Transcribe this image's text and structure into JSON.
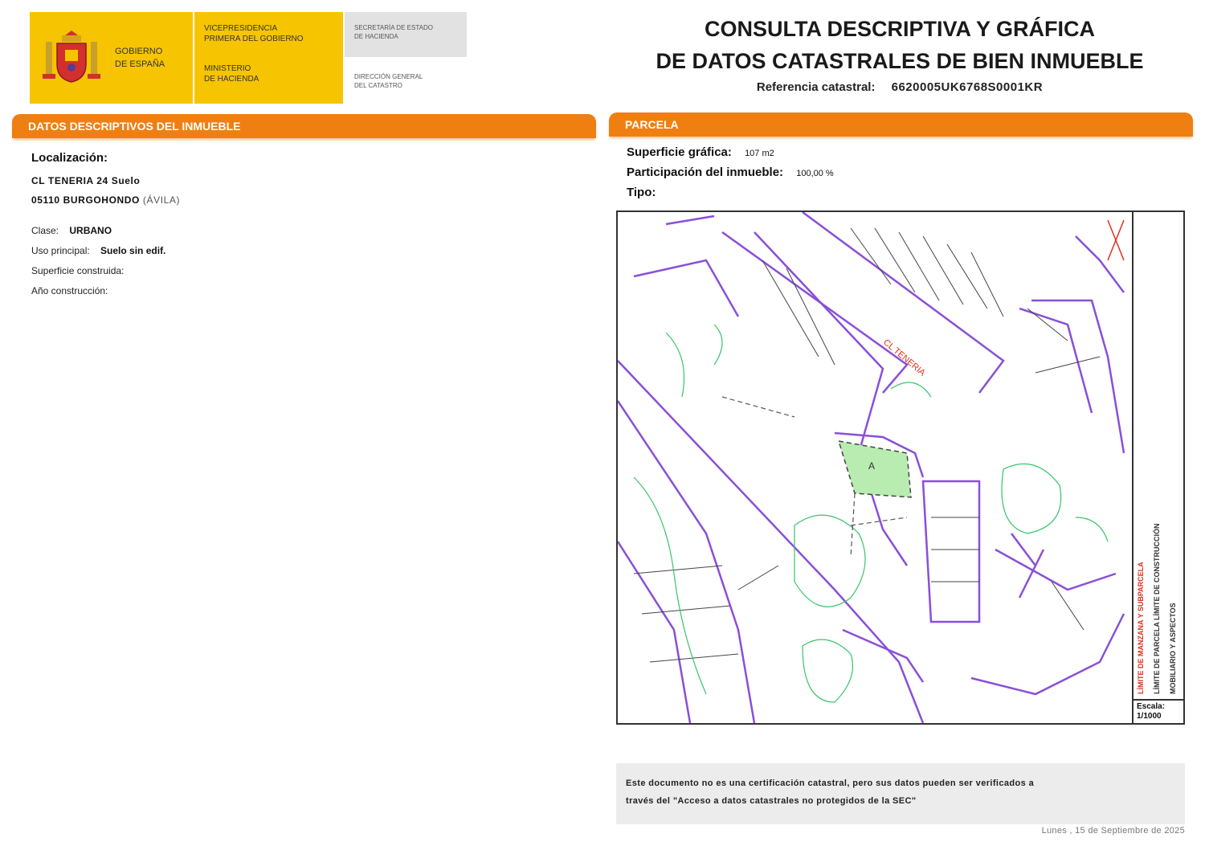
{
  "header": {
    "gov_name": [
      "GOBIERNO",
      "DE ESPAÑA"
    ],
    "vice_presidency": [
      "VICEPRESIDENCIA",
      "PRIMERA DEL GOBIERNO"
    ],
    "ministry": [
      "MINISTERIO",
      "DE HACIENDA"
    ],
    "secretariat": [
      "SECRETARÍA DE ESTADO",
      "DE HACIENDA"
    ],
    "directorate": [
      "DIRECCIÓN GENERAL",
      "DEL CATASTRO"
    ],
    "title_line1": "CONSULTA DESCRIPTIVA Y GRÁFICA",
    "title_line2": "DE DATOS CATASTRALES DE BIEN INMUEBLE",
    "ref_label": "Referencia catastral:",
    "ref_value": "6620005UK6768S0001KR"
  },
  "left_section": {
    "title": "DATOS DESCRIPTIVOS DEL INMUEBLE",
    "location_label": "Localización:",
    "address_line1": "CL TENERIA 24 Suelo",
    "address_line2": "05110 BURGOHONDO",
    "address_province": "(ÁVILA)",
    "clase_label": "Clase:",
    "clase_value": "URBANO",
    "uso_label": "Uso principal:",
    "uso_value": "Suelo sin edif.",
    "superficie_label": "Superficie construida:",
    "anio_label": "Año construcción:"
  },
  "right_section": {
    "title": "PARCELA",
    "superficie_label": "Superficie gráfica:",
    "superficie_value": "107 m2",
    "participacion_label": "Participación del inmueble:",
    "participacion_value": "100,00 %",
    "tipo_label": "Tipo:"
  },
  "map": {
    "street_label": "CL TENERIA",
    "scale_label": "Escala:",
    "scale_value": "1/1000",
    "legend_red": "LÍMITE DE MANZANA Y SUBPARCELA",
    "legend_mid": "LÍMITE DE PARCELA LÍMITE DE CONSTRUCCIÓN",
    "legend_right": "MOBILIARIO Y ASPECTOS",
    "colors": {
      "parcel_outline": "#8a4fd8",
      "vegetation": "#38c46a",
      "highlight": "#b8ecb0",
      "red_text": "#e0301e"
    }
  },
  "footer": {
    "disclaimer_line1": "Este documento no es una certificación catastral, pero sus datos pueden ser verificados a",
    "disclaimer_line2": "través del \"Acceso a datos catastrales no protegidos de la SEC\"",
    "date": "Lunes , 15 de Septiembre de 2025"
  }
}
